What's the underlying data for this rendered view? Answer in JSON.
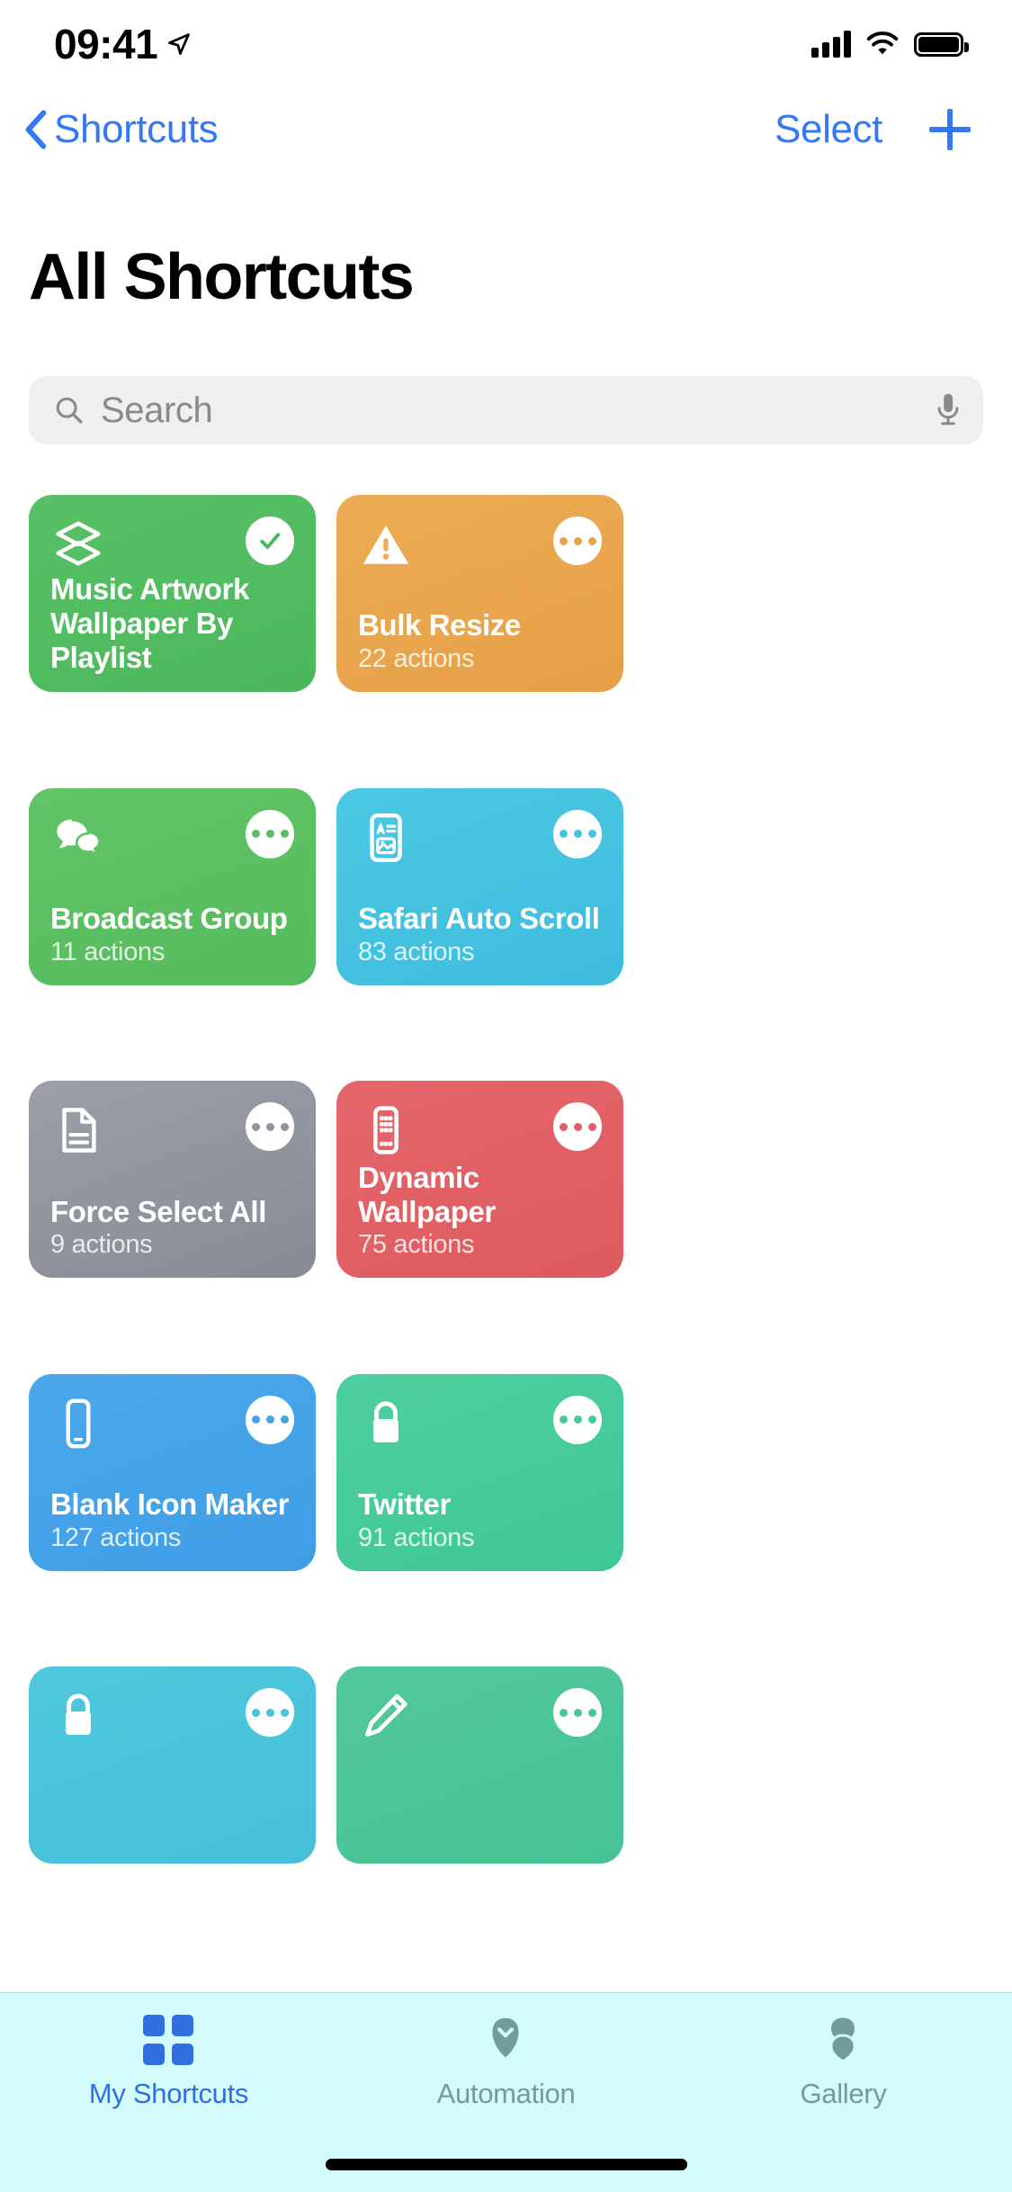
{
  "status_bar": {
    "time": "09:41",
    "location_icon": "location-arrow-icon",
    "signal_icon": "cellular-signal-icon",
    "wifi_icon": "wifi-icon",
    "battery_icon": "battery-full-icon"
  },
  "nav": {
    "back_label": "Shortcuts",
    "back_icon": "chevron-left-icon",
    "select_label": "Select",
    "add_icon": "plus-icon"
  },
  "page_title": "All Shortcuts",
  "search": {
    "placeholder": "Search",
    "value": "",
    "search_icon": "search-icon",
    "mic_icon": "microphone-icon"
  },
  "colors": {
    "accent": "#3478f6",
    "tab_active": "#2f6fe0",
    "tab_inactive": "#6f9c9c",
    "search_field": "#efeff0",
    "tabbar_background": "#d2fcfc"
  },
  "shortcuts": [
    {
      "title": "Music Artwork Wallpaper By Playlist",
      "subtitle": "",
      "color": "#54bf62",
      "color_end": "#4cb95b",
      "glyph": "layers-icon",
      "badge": "check-badge",
      "badge_color": "#54bf62"
    },
    {
      "title": "Bulk Resize",
      "subtitle": "22 actions",
      "color": "#eca84d",
      "color_end": "#e6a049",
      "glyph": "warning-triangle-icon",
      "badge": "ellipsis-badge",
      "badge_color": "#eca84d"
    },
    {
      "title": "Broadcast Group",
      "subtitle": "11 actions",
      "color": "#62c濃"
    }
  ],
  "cards": [
    {
      "title": "Music Artwork Wallpaper By Playlist",
      "subtitle": "",
      "bg_from": "#58c167",
      "bg_to": "#4bb75a",
      "glyph": "layers-icon",
      "badge": "check",
      "badge_color": "#4cb85c"
    },
    {
      "title": "Bulk Resize",
      "subtitle": "22 actions",
      "bg_from": "#edac55",
      "bg_to": "#e69f46",
      "glyph": "warning-triangle-icon",
      "badge": "ellipsis",
      "badge_color": "#e8a249"
    },
    {
      "title": "Broadcast Group",
      "subtitle": "11 actions",
      "bg_from": "#62c468",
      "bg_to": "#55bb5d",
      "glyph": "speech-bubbles-icon",
      "badge": "ellipsis",
      "badge_color": "#5bbd62"
    },
    {
      "title": "Safari Auto Scroll",
      "subtitle": "83 actions",
      "bg_from": "#4bc8e3",
      "bg_to": "#3fbcdd",
      "glyph": "document-media-icon",
      "badge": "ellipsis",
      "badge_color": "#45c2e0"
    },
    {
      "title": "Force Select All",
      "subtitle": "9 actions",
      "bg_from": "#9a9fa8",
      "bg_to": "#868b94",
      "glyph": "document-icon",
      "badge": "ellipsis",
      "badge_color": "#8f949d"
    },
    {
      "title": "Dynamic Wallpaper",
      "subtitle": "75 actions",
      "bg_from": "#e4666b",
      "bg_to": "#dd5b60",
      "glyph": "device-grid-icon",
      "badge": "ellipsis",
      "badge_color": "#e06065"
    },
    {
      "title": "Blank Icon Maker",
      "subtitle": "127 actions",
      "bg_from": "#4aa8ea",
      "bg_to": "#3f9ee6",
      "glyph": "iphone-icon",
      "badge": "ellipsis",
      "badge_color": "#45a3e8"
    },
    {
      "title": "Twitter",
      "subtitle": "91 actions",
      "bg_from": "#4ecf9e",
      "bg_to": "#3fc795",
      "glyph": "lock-icon",
      "badge": "ellipsis",
      "badge_color": "#46cb9a"
    },
    {
      "title": "",
      "subtitle": "",
      "bg_from": "#4fc8dd",
      "bg_to": "#45c0d8",
      "glyph": "lock-icon",
      "badge": "ellipsis",
      "badge_color": "#4ac4da"
    },
    {
      "title": "",
      "subtitle": "",
      "bg_from": "#52c89b",
      "bg_to": "#46c394",
      "glyph": "pencil-icon",
      "badge": "ellipsis",
      "badge_color": "#4cc698"
    }
  ],
  "tabs": [
    {
      "label": "My Shortcuts",
      "icon": "grid-squares-icon",
      "active": true
    },
    {
      "label": "Automation",
      "icon": "chevron-down-badge-icon",
      "active": false
    },
    {
      "label": "Gallery",
      "icon": "layers-stack-icon",
      "active": false
    }
  ]
}
